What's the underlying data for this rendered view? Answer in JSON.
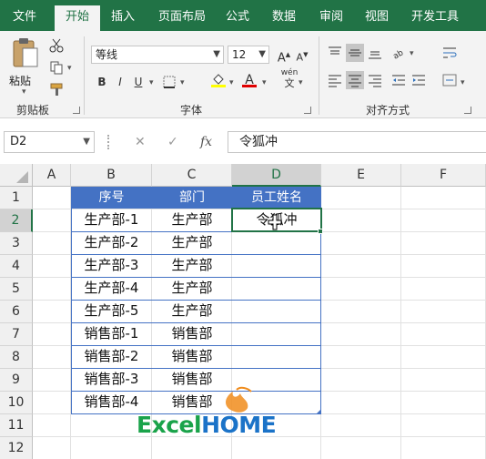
{
  "tabs": [
    {
      "label": "文件",
      "active": false
    },
    {
      "label": "开始",
      "active": true
    },
    {
      "label": "插入",
      "active": false
    },
    {
      "label": "页面布局",
      "active": false
    },
    {
      "label": "公式",
      "active": false
    },
    {
      "label": "数据",
      "active": false
    },
    {
      "label": "审阅",
      "active": false
    },
    {
      "label": "视图",
      "active": false
    },
    {
      "label": "开发工具",
      "active": false
    }
  ],
  "clipboard": {
    "paste_label": "粘贴",
    "group_label": "剪贴板"
  },
  "font": {
    "name": "等线",
    "size": "12",
    "bold": "B",
    "italic": "I",
    "underline": "U",
    "font_color_glyph": "A",
    "phonetic_glyph": "wén",
    "group_label": "字体"
  },
  "alignment": {
    "group_label": "对齐方式"
  },
  "formula_bar": {
    "name_box": "D2",
    "cancel_glyph": "✕",
    "enter_glyph": "✓",
    "fx_glyph": "fx",
    "value": "令狐冲"
  },
  "columns": [
    "A",
    "B",
    "C",
    "D",
    "E",
    "F"
  ],
  "rows": [
    "1",
    "2",
    "3",
    "4",
    "5",
    "6",
    "7",
    "8",
    "9",
    "10",
    "11",
    "12"
  ],
  "table": {
    "headers": [
      "序号",
      "部门",
      "员工姓名"
    ],
    "rows": [
      [
        "生产部-1",
        "生产部",
        "令狐冲"
      ],
      [
        "生产部-2",
        "生产部",
        ""
      ],
      [
        "生产部-3",
        "生产部",
        ""
      ],
      [
        "生产部-4",
        "生产部",
        ""
      ],
      [
        "生产部-5",
        "生产部",
        ""
      ],
      [
        "销售部-1",
        "销售部",
        ""
      ],
      [
        "销售部-2",
        "销售部",
        ""
      ],
      [
        "销售部-3",
        "销售部",
        ""
      ],
      [
        "销售部-4",
        "销售部",
        ""
      ]
    ]
  },
  "active_cell": "D2",
  "watermark": {
    "left": "Excel",
    "right": "HOME"
  },
  "colors": {
    "ribbon_green": "#217346",
    "table_header_blue": "#4472c4",
    "logo_green": "#1aa34a",
    "logo_blue": "#1b73c8",
    "logo_orange": "#f08c1c"
  }
}
